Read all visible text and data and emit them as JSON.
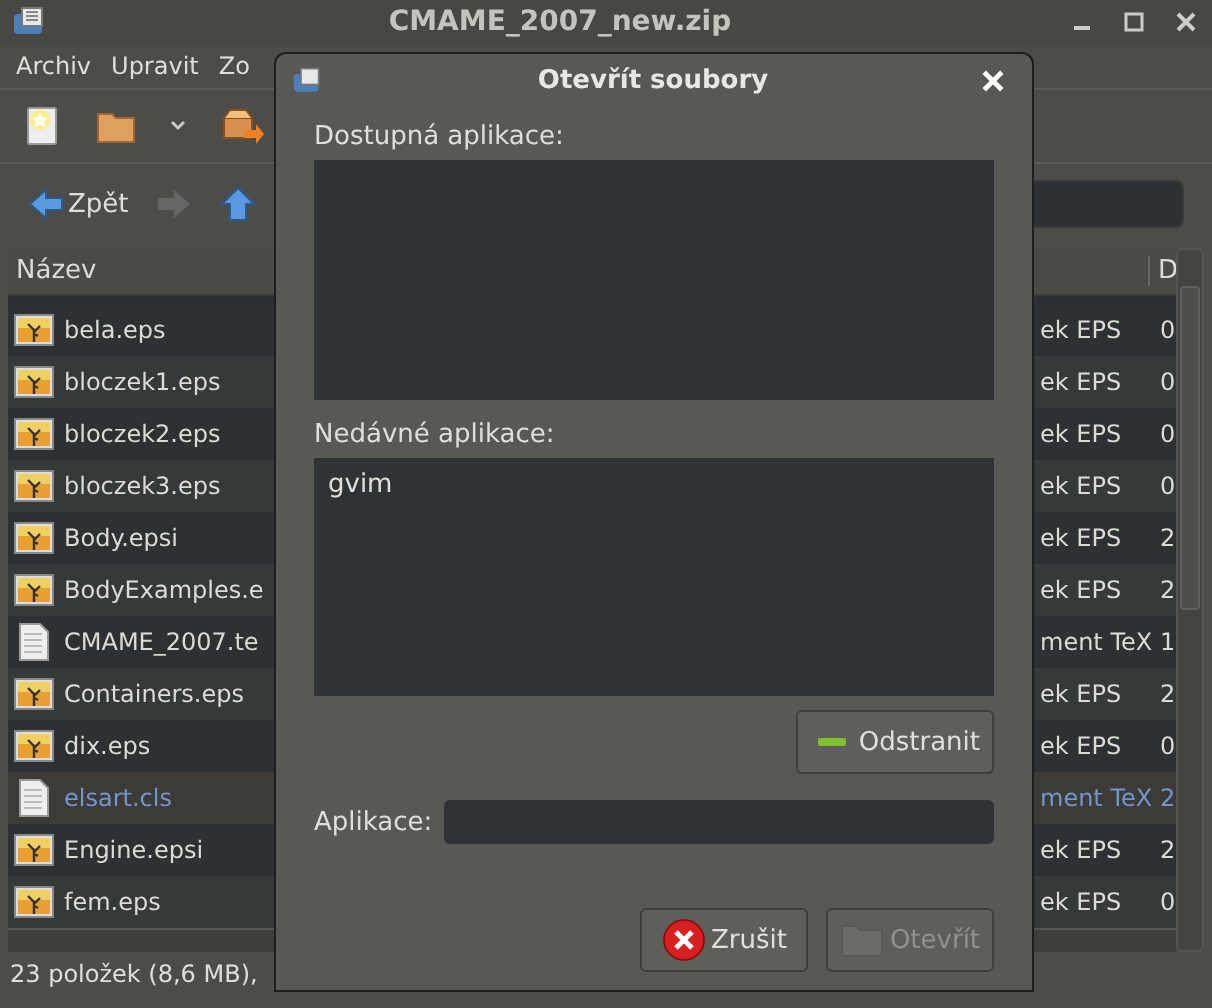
{
  "window": {
    "title": "CMAME_2007_new.zip"
  },
  "menu": [
    {
      "label": "Archiv"
    },
    {
      "label": "Upravit"
    },
    {
      "label": "Zo"
    }
  ],
  "navigation": [
    {
      "kind": "back",
      "label": "Zpět",
      "disabled": false
    },
    {
      "kind": "forward",
      "disabled": true
    },
    {
      "kind": "up",
      "disabled": false
    }
  ],
  "file_list": {
    "columns": [
      {
        "label": "Název"
      },
      {
        "label": "D"
      }
    ],
    "rows": [
      {
        "kind": "image",
        "name": "bela.eps",
        "type": "ek EPS",
        "column_3": "0",
        "selected": false
      },
      {
        "kind": "image",
        "name": "bloczek1.eps",
        "type": "ek EPS",
        "column_3": "0",
        "selected": false
      },
      {
        "kind": "image",
        "name": "bloczek2.eps",
        "type": "ek EPS",
        "column_3": "0",
        "selected": false
      },
      {
        "kind": "image",
        "name": "bloczek3.eps",
        "type": "ek EPS",
        "column_3": "0",
        "selected": false
      },
      {
        "kind": "image",
        "name": "Body.epsi",
        "type": "ek EPS",
        "column_3": "2",
        "selected": false
      },
      {
        "kind": "image",
        "name": "BodyExamples.e",
        "type": "ek EPS",
        "column_3": "2",
        "selected": false
      },
      {
        "kind": "text",
        "name": "CMAME_2007.te",
        "type": "ment TeX",
        "column_3": "1",
        "selected": false
      },
      {
        "kind": "image",
        "name": "Containers.eps",
        "type": "ek EPS",
        "column_3": "2",
        "selected": false
      },
      {
        "kind": "image",
        "name": "dix.eps",
        "type": "ek EPS",
        "column_3": "0",
        "selected": false
      },
      {
        "kind": "text",
        "name": "elsart.cls",
        "type": "ment TeX",
        "column_3": "2",
        "selected": true
      },
      {
        "kind": "image",
        "name": "Engine.epsi",
        "type": "ek EPS",
        "column_3": "2",
        "selected": false
      },
      {
        "kind": "image",
        "name": "fem.eps",
        "type": "ek EPS",
        "column_3": "0",
        "selected": false
      }
    ]
  },
  "status_bar": "23 položek (8,6 MB),",
  "dialog": {
    "title": "Otevřít soubory",
    "available_label": "Dostupná aplikace:",
    "recent_label": "Nedávné aplikace:",
    "recent_apps": [
      {
        "name": "gvim",
        "selected": false
      }
    ],
    "remove_button": "Odstranit",
    "app_label": "Aplikace:",
    "buttons": [
      {
        "kind": "cancel",
        "label": "Zrušit",
        "disabled": false
      },
      {
        "kind": "open",
        "label": "Otevřít",
        "disabled": true
      }
    ]
  }
}
